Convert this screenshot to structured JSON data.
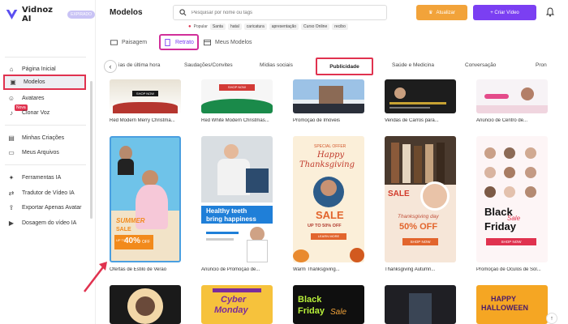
{
  "brand": {
    "name": "Vidnoz AI",
    "badge": "EXPIRADO"
  },
  "header": {
    "title": "Modelos",
    "search_placeholder": "Pesquisar por nome ou tags",
    "upgrade": "Atualizar",
    "create": "+ Criar Vídeo"
  },
  "popular": {
    "label": "Popular",
    "tags": [
      "Santa",
      "hatal",
      "caricatura",
      "apresentação",
      "Curso Online",
      "recibo"
    ]
  },
  "sidebar": {
    "items": [
      {
        "label": "Página Inicial",
        "icon": "home-icon"
      },
      {
        "label": "Modelos",
        "icon": "templates-icon"
      },
      {
        "label": "Avatares",
        "icon": "avatar-icon"
      },
      {
        "label": "Clonar Voz",
        "icon": "voice-icon"
      },
      {
        "label": "Minhas Criações",
        "icon": "creations-icon"
      },
      {
        "label": "Meus Arquivos",
        "icon": "files-icon"
      },
      {
        "label": "Ferramentas IA",
        "icon": "tools-icon"
      },
      {
        "label": "Tradutor de Vídeo IA",
        "icon": "translate-icon"
      },
      {
        "label": "Exportar Apenas Avatar",
        "icon": "export-icon"
      },
      {
        "label": "Dosagem do vídeo IA",
        "icon": "video-icon"
      }
    ],
    "nova_badge": "Nova"
  },
  "orientation_tabs": [
    "Paisagem",
    "Retrato",
    "Meus Modelos"
  ],
  "categories": [
    "ias de última hora",
    "Saudações/Convites",
    "Mídias sociais",
    "Publicidade",
    "Saúde e Medicina",
    "Conversação",
    "Pron"
  ],
  "row1_captions": [
    "Red Modern Merry Christma...",
    "Red White Modern Christmas...",
    "Promoção de Imóveis",
    "Vendas de Carros para...",
    "Anúncio de Centro de..."
  ],
  "row2_captions": [
    "Ofertas de Estilo de Verão",
    "Anúncio de Promoção de...",
    "Warm Thanksgiving...",
    "Thanksgiving Autumn...",
    "Promoção de Óculos de Sol..."
  ],
  "card_texts": {
    "summer": {
      "line1": "SUMMER",
      "line2": "SALE",
      "line3": "UP TO",
      "pct": "40%",
      "off": "OFF"
    },
    "dental": {
      "line1": "Healthy teeth",
      "line2": "bring happiness"
    },
    "warm": {
      "tag": "SPECIAL OFFER",
      "title1": "Happy",
      "title2": "Thanksgiving",
      "sale": "SALE",
      "upto": "UP TO 50% OFF",
      "btn": "LEARN MORE"
    },
    "autumn": {
      "title": "Thanksgiving day",
      "pct": "50% OFF",
      "btn": "SHOP NOW",
      "sale": "SALE"
    },
    "glasses": {
      "black": "Black",
      "friday": "Friday",
      "sale": "Sale",
      "btn": "SHOP NOW"
    },
    "row3": {
      "cyber1": "Cyber",
      "cyber2": "Monday",
      "bf1": "Black",
      "bf2": "Friday",
      "bf3": "Sale",
      "hh1": "HAPPY",
      "hh2": "HALLOWEEN"
    },
    "shop_now": "SHOP NOW"
  },
  "colors": {
    "accent": "#7b3ff2",
    "highlight": "#e0324f",
    "upgrade": "#f2a33a"
  }
}
